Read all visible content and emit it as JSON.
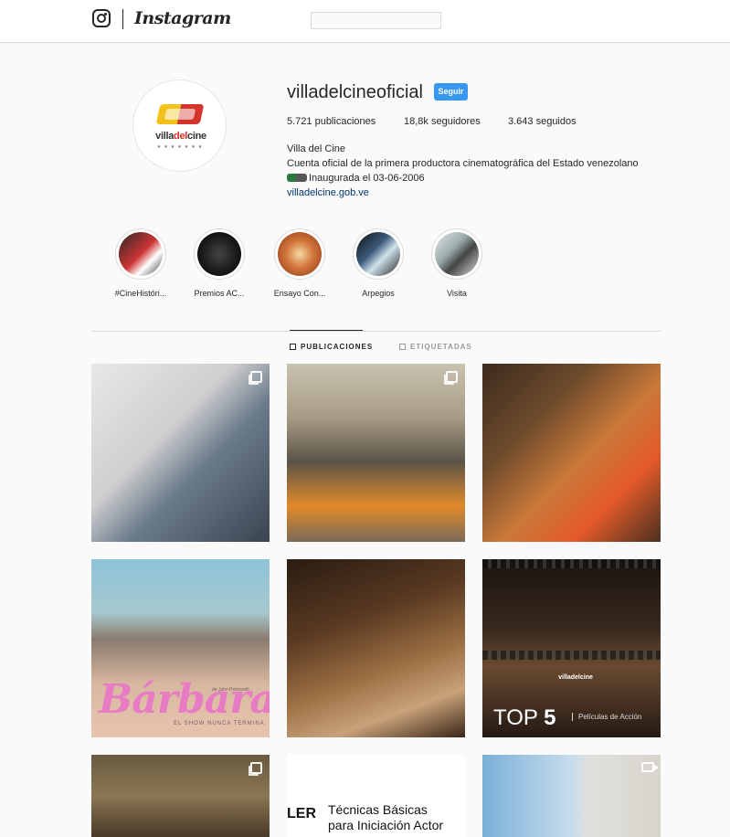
{
  "nav": {
    "wordmark": "Instagram",
    "search_placeholder": ""
  },
  "profile": {
    "username": "villadelcineoficial",
    "follow_label": "Seguir",
    "avatar_brand_pre": "villa",
    "avatar_brand_del": "del",
    "avatar_brand_post": "cine",
    "stats": {
      "posts": "5.721 publicaciones",
      "followers": "18,8k seguidores",
      "following": "3.643 seguidos"
    },
    "bio": {
      "name": "Villa del Cine",
      "line1": "Cuenta oficial de la primera productora cinematográfica del Estado venezolano",
      "line2": "Inaugurada el 03-06-2006",
      "link": "villadelcine.gob.ve"
    }
  },
  "highlights": [
    {
      "label": "#CineHistóri...",
      "color": "#9c2a2a"
    },
    {
      "label": "Premios AC...",
      "color": "#1a1a1a"
    },
    {
      "label": "Ensayo Con...",
      "color": "#c56a3a"
    },
    {
      "label": "Arpegios",
      "color": "#3a4a5a"
    },
    {
      "label": "Visita",
      "color": "#8a8a9a"
    }
  ],
  "tabs": {
    "posts": "PUBLICACIONES",
    "tagged": "ETIQUETADAS"
  },
  "posts": {
    "barbara_title": "Bárbara",
    "barbara_sub": "EL SHOW NUNCA TERMINA",
    "barbara_credit": "de John Petrizzelli",
    "top5_pre": "TOP",
    "top5_num": "5",
    "top5_sub": "Películas de Acción",
    "vdc_small": "villadelcine",
    "ler": "LER",
    "tecnicas_1": "Técnicas Básicas",
    "tecnicas_2": "para Iniciación Actor"
  }
}
